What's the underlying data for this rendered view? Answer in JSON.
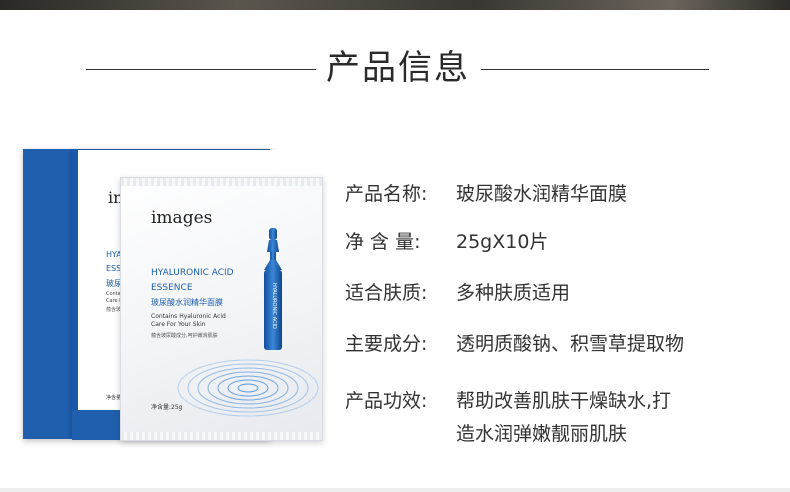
{
  "section_title": "产品信息",
  "product_image": {
    "box": {
      "brand": "images",
      "line1": "HYALURONIC ACID",
      "line2": "ESSENCE",
      "line3": "玻尿酸水润精华面膜",
      "line4": "Contains Hyaluronic Acid",
      "line5": "Care For Your Skin",
      "line6": "蕴含玻尿酸成分,呵护嫩滑肌肤",
      "net": "净含量:25g"
    },
    "sachet": {
      "brand": "images",
      "line1": "HYALURONIC ACID",
      "line2": "ESSENCE",
      "line3": "玻尿酸水润精华面膜",
      "line4": "Contains Hyaluronic Acid",
      "line5": "Care For Your Skin",
      "line6": "蕴含玻尿酸成分,呵护嫩滑肌肤",
      "net": "净含量:25g",
      "ampoule_text": "HYALURONIC ACID"
    }
  },
  "specs": [
    {
      "label": "产品名称:",
      "value": "玻尿酸水润精华面膜"
    },
    {
      "label": "净 含 量:",
      "value": "25gX10片"
    },
    {
      "label": "适合肤质:",
      "value": "多种肤质适用"
    },
    {
      "label": "主要成分:",
      "value": "透明质酸钠、积雪草提取物"
    },
    {
      "label": "产品功效:",
      "value": "帮助改善肌肤干燥缺水,打",
      "continuation": "造水润弹嫩靓丽肌肤"
    }
  ],
  "colors": {
    "brand_blue": "#1f5fae",
    "text": "#333333"
  }
}
